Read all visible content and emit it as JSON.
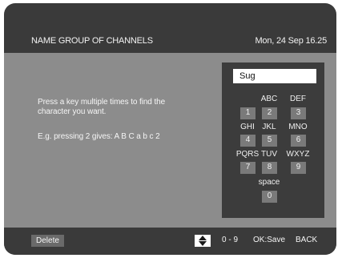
{
  "header": {
    "title": "NAME GROUP OF CHANNELS",
    "datetime": "Mon, 24 Sep 16.25"
  },
  "instructions": {
    "line1": "Press a key multiple times to find the",
    "line2": "character you want.",
    "example": "E.g. pressing 2 gives:  A  B  C  a  b  c  2"
  },
  "entry": {
    "value": "Sug"
  },
  "keypad": {
    "keys": [
      {
        "digit": "1",
        "letters": ""
      },
      {
        "digit": "2",
        "letters": "ABC"
      },
      {
        "digit": "3",
        "letters": "DEF"
      },
      {
        "digit": "4",
        "letters": "GHI"
      },
      {
        "digit": "5",
        "letters": "JKL"
      },
      {
        "digit": "6",
        "letters": "MNO"
      },
      {
        "digit": "7",
        "letters": "PQRS"
      },
      {
        "digit": "8",
        "letters": "TUV"
      },
      {
        "digit": "9",
        "letters": "WXYZ"
      },
      {
        "digit": "0",
        "letters": "space"
      }
    ]
  },
  "footer": {
    "delete_label": "Delete",
    "nav_icon": "up-down-arrows-icon",
    "digits_hint": "0 - 9",
    "save_hint": "OK:Save",
    "back_hint": "BACK"
  },
  "colors": {
    "frame": "#3a3a3a",
    "content": "#8c8c8c",
    "keypad_bg": "#3c3c3c",
    "key_bg": "#7a7a7a",
    "text": "#f2f2f2"
  }
}
